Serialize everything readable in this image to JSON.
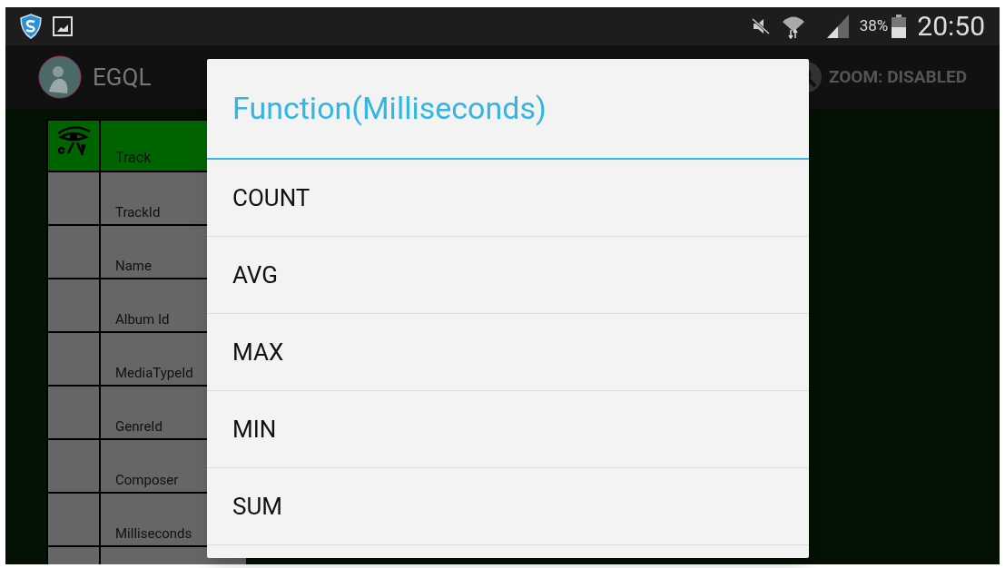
{
  "status_bar": {
    "battery": "38%",
    "time": "20:50"
  },
  "action_bar": {
    "title": "EGQL",
    "zoom": "ZOOM: DISABLED"
  },
  "table": {
    "header": "Track",
    "rows": [
      "TrackId",
      "Name",
      "Album Id",
      "MediaTypeId",
      "GenreId",
      "Composer",
      "Milliseconds",
      ""
    ]
  },
  "dialog": {
    "title": "Function(Milliseconds)",
    "items": [
      "COUNT",
      "AVG",
      "MAX",
      "MIN",
      "SUM"
    ]
  }
}
